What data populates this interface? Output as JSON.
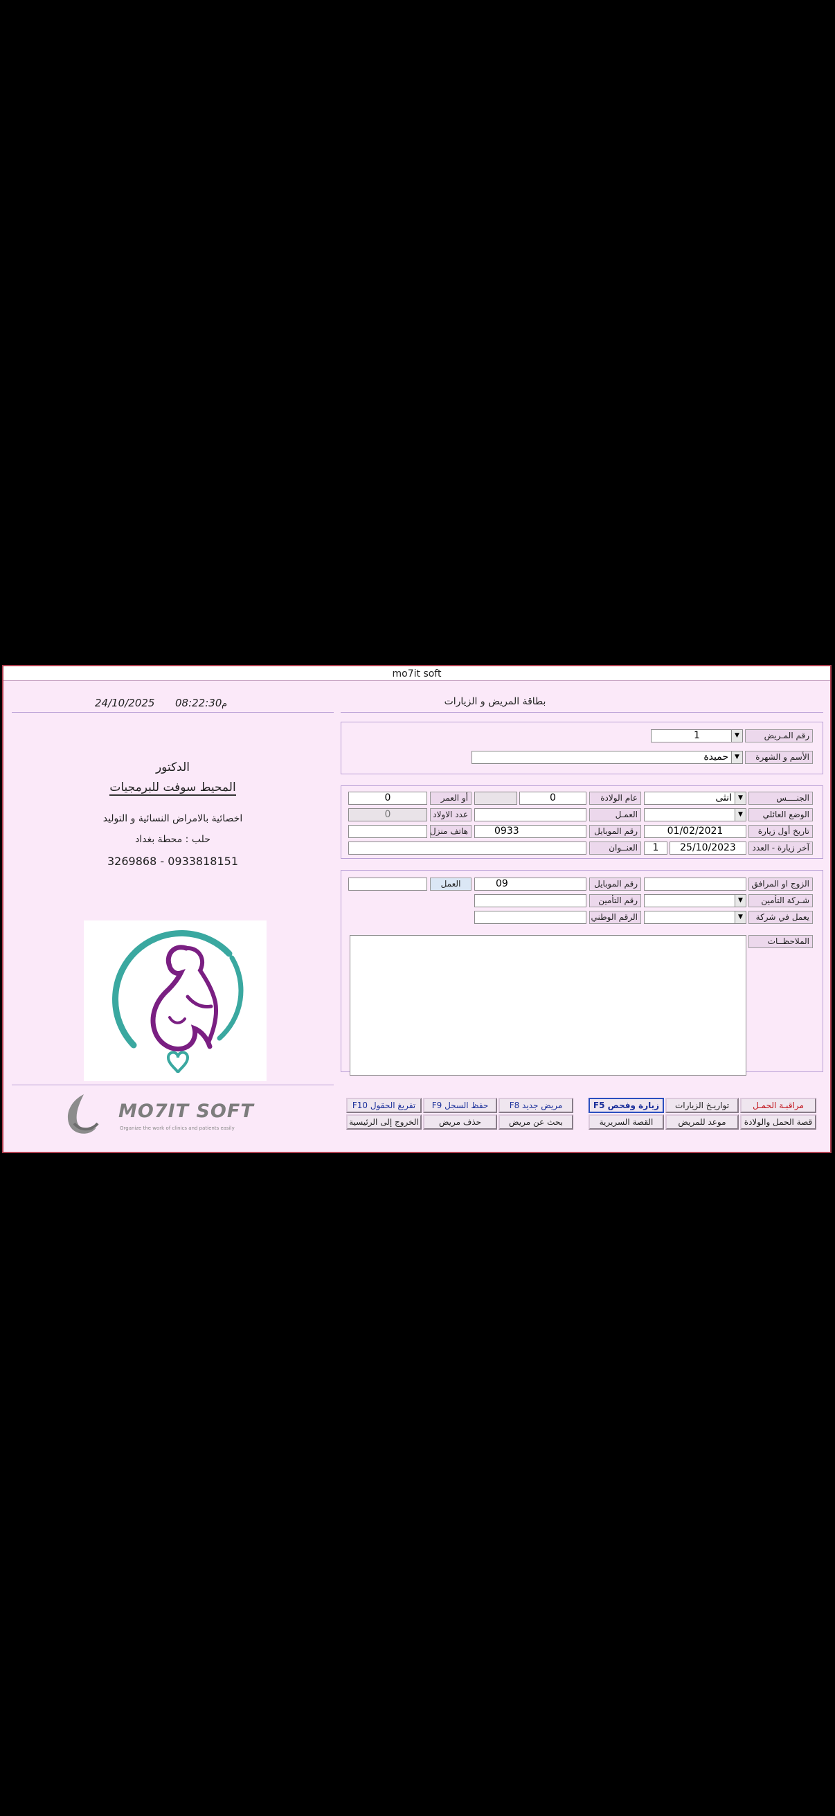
{
  "window": {
    "title": "mo7it soft"
  },
  "header": {
    "time_suffix": "م",
    "time": "08:22:30",
    "date": "24/10/2025",
    "section_title": "بطاقة المريض و الزيارات"
  },
  "doctor": {
    "title": "الدكتور",
    "name": "المحيط سوفت للبرمجيات",
    "specialty": "اخصائية بالامراض النسائية و التوليد",
    "address": "حلب : محطة بغداد",
    "phones": "0933818151 - 3269868"
  },
  "logo": {
    "brand": "MO7IT SOFT",
    "tagline": "Organize the work of clinics and patients easily"
  },
  "patient": {
    "number_label": "رقم المـريض",
    "number_value": "1",
    "name_label": "الأسم و الشهرة",
    "name_value": "حميدة"
  },
  "info": {
    "gender_label": "الجنــــس",
    "gender_value": "انثى",
    "birth_year_label": "عام الولادة",
    "birth_year_value": "0",
    "age_label": "أو العمر",
    "age_value": "0",
    "marital_label": "الوضع العائلي",
    "work_label": "العمـل",
    "children_label": "عدد الاولاد",
    "children_value": "0",
    "first_visit_label": "تاريخ أول زيارة",
    "first_visit_value": "01/02/2021",
    "mobile_label": "رقم الموبايل",
    "mobile_value": "0933",
    "home_phone_label": "هاتف منزل",
    "last_visit_label": "آخر زيارة - العدد",
    "last_visit_value": "25/10/2023",
    "visit_count": "1",
    "address_label": "العنــوان"
  },
  "companion": {
    "spouse_label": "الزوج او المرافق",
    "spouse_mobile_label": "رقم الموبايل",
    "spouse_mobile_value": "09",
    "work_label": "العمل",
    "insurance_company_label": "شـركة التأمين",
    "insurance_number_label": "رقم التأمين",
    "employer_label": "يعمل في شركة",
    "national_id_label": "الرقم الوطني",
    "notes_label": "الملاحظــات"
  },
  "buttons": {
    "pregnancy_monitor": "مراقبـة الحمـل",
    "visit_dates": "تواريـخ الزيارات",
    "visit_exam": "زيارة وفحص F5",
    "new_patient": "مريض جديد F8",
    "save_record": "حفظ السجل F9",
    "clear_fields": "تفريغ الحقول F10",
    "pregnancy_birth_history": "قصة الحمل والولادة",
    "patient_appointment": "موعد للمريض",
    "clinical_history": "القصة السريرية",
    "search_patient": "بحث عن مريض",
    "delete_patient": "حذف مريض",
    "back_main": "الخروج إلى الرئيسية"
  },
  "colors": {
    "window_bg": "#fbe9f9",
    "border": "#b04050",
    "teal": "#3aa8a0",
    "purple": "#7a1f82"
  }
}
